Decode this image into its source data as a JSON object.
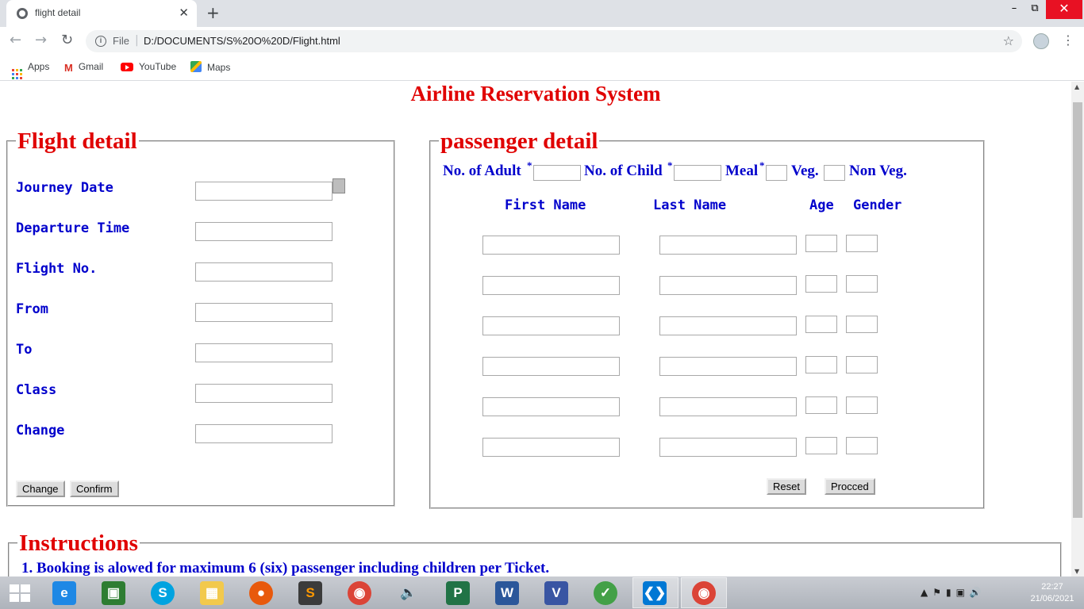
{
  "browser": {
    "tab_title": "flight detail",
    "new_tab": "+",
    "close_tab": "✕",
    "url_scheme": "File",
    "url": "D:/DOCUMENTS/S%20O%20D/Flight.html",
    "bookmarks": [
      {
        "label": "Apps",
        "icon": "apps-grid-icon"
      },
      {
        "label": "Gmail",
        "icon": "gmail-icon"
      },
      {
        "label": "YouTube",
        "icon": "youtube-icon"
      },
      {
        "label": "Maps",
        "icon": "maps-icon"
      }
    ]
  },
  "page": {
    "title": "Airline Reservation System",
    "flight": {
      "legend": "Flight detail",
      "fields": [
        {
          "label": "Journey Date",
          "value": ""
        },
        {
          "label": "Departure Time",
          "value": ""
        },
        {
          "label": "Flight No.",
          "value": ""
        },
        {
          "label": "From",
          "value": ""
        },
        {
          "label": "To",
          "value": ""
        },
        {
          "label": "Class",
          "value": ""
        },
        {
          "label": "Change",
          "value": ""
        }
      ],
      "buttons": {
        "change": "Change",
        "confirm": "Confirm"
      }
    },
    "passenger": {
      "legend": "passenger detail",
      "adult_label": "No. of Adult",
      "child_label": "No. of Child",
      "meal_label": "Meal",
      "required_mark": "*",
      "veg_label": "Veg.",
      "nonveg_label": "Non Veg.",
      "columns": {
        "first": "First Name",
        "last": "Last Name",
        "age": "Age",
        "gender": "Gender"
      },
      "rows": [
        {
          "first": "",
          "last": "",
          "age": "",
          "gender": ""
        },
        {
          "first": "",
          "last": "",
          "age": "",
          "gender": ""
        },
        {
          "first": "",
          "last": "",
          "age": "",
          "gender": ""
        },
        {
          "first": "",
          "last": "",
          "age": "",
          "gender": ""
        },
        {
          "first": "",
          "last": "",
          "age": "",
          "gender": ""
        },
        {
          "first": "",
          "last": "",
          "age": "",
          "gender": ""
        }
      ],
      "buttons": {
        "reset": "Reset",
        "proceed": "Procced"
      }
    },
    "instructions": {
      "legend": "Instructions",
      "items": [
        "1. Booking is alowed for maximum 6 (six) passenger including children per Ticket."
      ]
    }
  },
  "taskbar": {
    "clock_time": "22:27",
    "clock_date": "21/06/2021"
  },
  "colors": {
    "heading_red": "#e00000",
    "label_blue": "#0000cc"
  }
}
